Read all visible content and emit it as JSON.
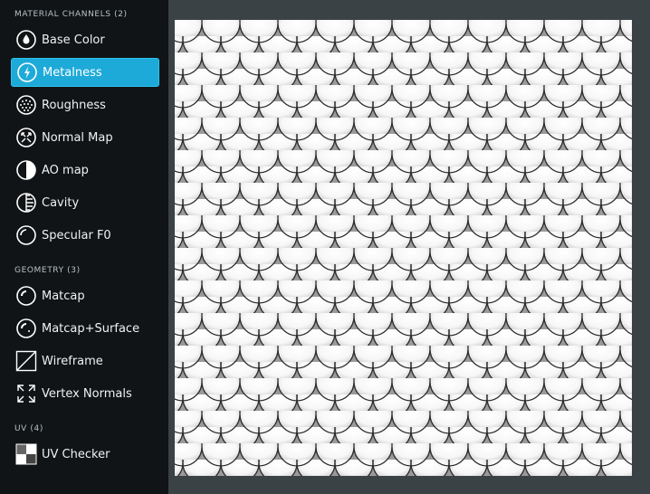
{
  "sections": [
    {
      "title": "MATERIAL CHANNELS (2)",
      "items": [
        {
          "label": "Base Color",
          "icon": "base-color-icon"
        },
        {
          "label": "Metalness",
          "icon": "metalness-icon",
          "selected": true
        },
        {
          "label": "Roughness",
          "icon": "roughness-icon"
        },
        {
          "label": "Normal Map",
          "icon": "normal-map-icon"
        },
        {
          "label": "AO map",
          "icon": "ao-map-icon"
        },
        {
          "label": "Cavity",
          "icon": "cavity-icon"
        },
        {
          "label": "Specular F0",
          "icon": "specular-f0-icon"
        }
      ]
    },
    {
      "title": "GEOMETRY (3)",
      "items": [
        {
          "label": "Matcap",
          "icon": "matcap-icon"
        },
        {
          "label": "Matcap+Surface",
          "icon": "matcap-surface-icon"
        },
        {
          "label": "Wireframe",
          "icon": "wireframe-icon"
        },
        {
          "label": "Vertex Normals",
          "icon": "vertex-normals-icon"
        }
      ]
    },
    {
      "title": "UV (4)",
      "items": [
        {
          "label": "UV Checker",
          "icon": "uv-checker-icon"
        }
      ]
    }
  ],
  "colors": {
    "sidebar_bg": "#111416",
    "accent": "#1eaad8",
    "viewport_bg": "#3a4245"
  }
}
